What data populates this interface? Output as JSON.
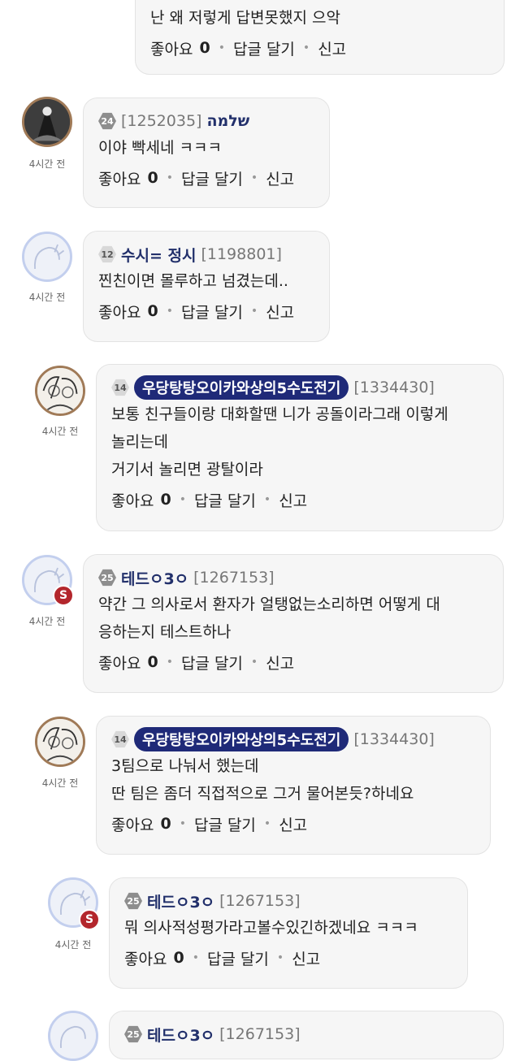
{
  "ui": {
    "like_label": "좋아요",
    "reply_label": "답글 달기",
    "report_label": "신고",
    "time_label": "4시간 전",
    "s_badge": "S"
  },
  "comments": [
    {
      "body_lines": [
        "난 왜 저렇게 답변못했지 으악"
      ],
      "likes": "0"
    },
    {
      "level": "24",
      "uid": "[1252035]",
      "nick": "שלמה",
      "body_lines": [
        "이야 빡세네 ㅋㅋㅋ"
      ],
      "likes": "0"
    },
    {
      "level": "12",
      "nick": "수시= 정시",
      "uid": "[1198801]",
      "body_lines": [
        "찐친이면 몰루하고 넘겼는데.."
      ],
      "likes": "0"
    },
    {
      "level": "14",
      "nick": "우당탕탕오이카와상의5수도전기",
      "uid": "[1334430]",
      "body_lines": [
        "보통 친구들이랑 대화할땐 니가 공돌이라그래 이렇게",
        "놀리는데",
        "거기서 놀리면 광탈이라"
      ],
      "likes": "0"
    },
    {
      "level": "25",
      "nick": "테드ㅇ3ㅇ",
      "uid": "[1267153]",
      "body_lines": [
        "약간 그 의사로서 환자가 얼탱없는소리하면 어떻게 대",
        "응하는지 테스트하나"
      ],
      "likes": "0"
    },
    {
      "level": "14",
      "nick": "우당탕탕오이카와상의5수도전기",
      "uid": "[1334430]",
      "body_lines": [
        "3팀으로 나눠서 했는데",
        "딴 팀은 좀더 직접적으로 그거 물어본듯?하네요"
      ],
      "likes": "0"
    },
    {
      "level": "25",
      "nick": "테드ㅇ3ㅇ",
      "uid": "[1267153]",
      "body_lines": [
        "뭐 의사적성평가라고볼수있긴하겠네요 ㅋㅋㅋ"
      ],
      "likes": "0"
    },
    {
      "level": "25",
      "nick": "테드ㅇ3ㅇ",
      "uid": "[1267153]"
    }
  ]
}
